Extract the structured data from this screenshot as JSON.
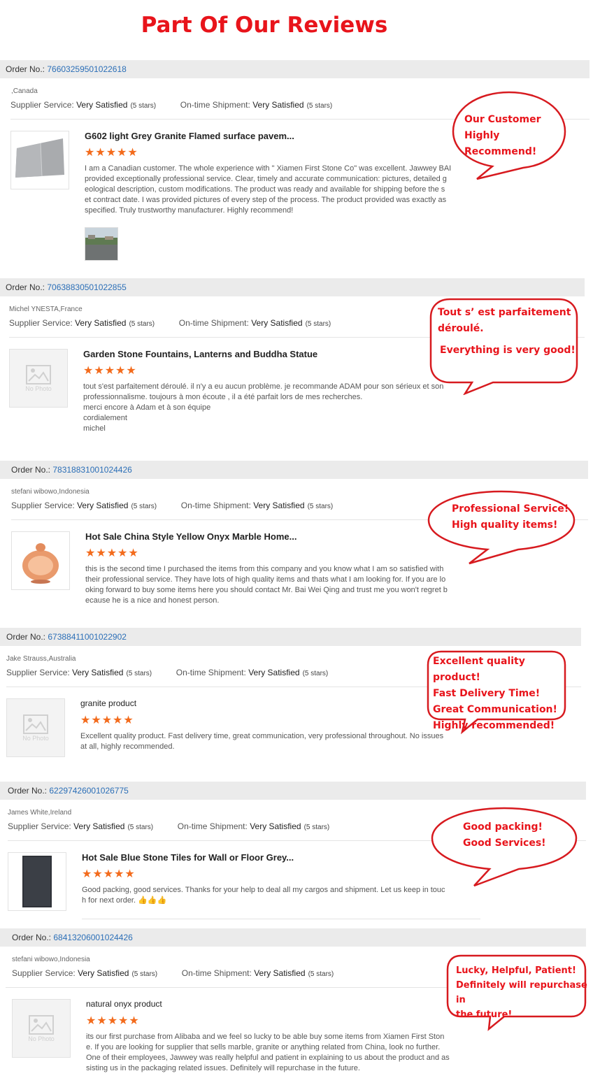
{
  "page": {
    "title": "Part Of Our Reviews"
  },
  "labels": {
    "order_no": "Order No.:",
    "supplier_service": "Supplier Service:",
    "on_time_shipment": "On-time Shipment:",
    "no_photo": "No Photo"
  },
  "star_glyph": "★★★★★",
  "colors": {
    "accent_red": "#e8141b",
    "star_orange": "#f36b1c",
    "order_link": "#2c6fb7"
  },
  "reviews": [
    {
      "order_number": "76603259501022618",
      "buyer": ",Canada",
      "supplier_rating": "Very Satisfied",
      "supplier_stars": "(5 stars)",
      "shipment_rating": "Very Satisfied",
      "shipment_stars": "(5 stars)",
      "product_title": "G602 light Grey Granite Flamed surface pavem...",
      "rating": 5,
      "text": "I am a Canadian customer. The whole experience with \" Xiamen First Stone Co\" was excellent. Jawwey BAI\nprovided exceptionally professional service. Clear, timely and accurate communication: pictures, detailed g\neological description, custom modifications. The product was ready and available for shipping before the s\net contract date.  I was provided pictures of every step of the process. The product provided was exactly as\nspecified. Truly trustworthy manufacturer. Highly recommend!",
      "bubble_lines": [
        "Our Customer",
        "Highly Recommend!"
      ]
    },
    {
      "order_number": "70638830501022855",
      "buyer": "Michel YNESTA,France",
      "supplier_rating": "Very Satisfied",
      "supplier_stars": "(5 stars)",
      "shipment_rating": "Very Satisfied",
      "shipment_stars": "(5 stars)",
      "product_title": "Garden Stone Fountains, Lanterns and Buddha Statue",
      "rating": 5,
      "text": "tout s'est parfaitement déroulé. il n'y a eu aucun problème. je recommande ADAM pour son sérieux et son\nprofessionnalisme. toujours à mon écoute , il a été parfait lors de mes recherches.\nmerci encore à Adam et à son équipe\ncordialement\nmichel",
      "bubble_lines": [
        "Tout s’ est parfaitement",
        "déroulé.",
        "Everything is very good!"
      ]
    },
    {
      "order_number": "78318831001024426",
      "buyer": "stefani wibowo,Indonesia",
      "supplier_rating": "Very Satisfied",
      "supplier_stars": "(5 stars)",
      "shipment_rating": "Very Satisfied",
      "shipment_stars": "(5 stars)",
      "product_title": "Hot Sale China Style Yellow Onyx Marble Home...",
      "rating": 5,
      "text": "this is the second time I purchased the items from this company and you know what I am so satisfied with\ntheir professional service. They have lots of high quality items and thats what I am looking for. If you are lo\noking forward to buy some items here you should contact Mr. Bai Wei Qing and trust me you won't regret b\necause he is a nice and honest person.",
      "bubble_lines": [
        "Professional Service!",
        "High quality items!"
      ]
    },
    {
      "order_number": "67388411001022902",
      "buyer": "Jake Strauss,Australia",
      "supplier_rating": "Very Satisfied",
      "supplier_stars": "(5 stars)",
      "shipment_rating": "Very Satisfied",
      "shipment_stars": "(5 stars)",
      "product_title": "granite product",
      "rating": 5,
      "text": "Excellent quality product. Fast delivery time, great communication, very professional throughout. No issues\nat all, highly recommended.",
      "bubble_lines": [
        "Excellent quality product!",
        "Fast Delivery Time!",
        "Great Communication!",
        "Highly recommended!"
      ]
    },
    {
      "order_number": "62297426001026775",
      "buyer": "James White,Ireland",
      "supplier_rating": "Very Satisfied",
      "supplier_stars": "(5 stars)",
      "shipment_rating": "Very Satisfied",
      "shipment_stars": "(5 stars)",
      "product_title": "Hot Sale Blue Stone Tiles for Wall or Floor Grey...",
      "rating": 5,
      "text": "Good packing, good services. Thanks for your help to deal all my cargos and shipment. Let us keep in touc\nh for next order. 👍👍👍",
      "bubble_lines": [
        "Good packing!",
        "Good Services!"
      ]
    },
    {
      "order_number": "68413206001024426",
      "buyer": "stefani wibowo,Indonesia",
      "supplier_rating": "Very Satisfied",
      "supplier_stars": "(5 stars)",
      "shipment_rating": "Very Satisfied",
      "shipment_stars": "(5 stars)",
      "product_title": "natural onyx product",
      "rating": 5,
      "text": "its our first purchase from Alibaba and we feel so lucky to be able buy some items from Xiamen First Ston\ne. If you are looking for supplier that sells marble, granite or anything related from China, look no further.\nOne of their employees, Jawwey was really helpful and patient in explaining to us about the product and as\nsisting us in the packaging related issues. Definitely will repurchase in the future.",
      "bubble_lines": [
        "Lucky, Helpful, Patient!",
        "Definitely will repurchase in",
        "the future!"
      ]
    }
  ]
}
